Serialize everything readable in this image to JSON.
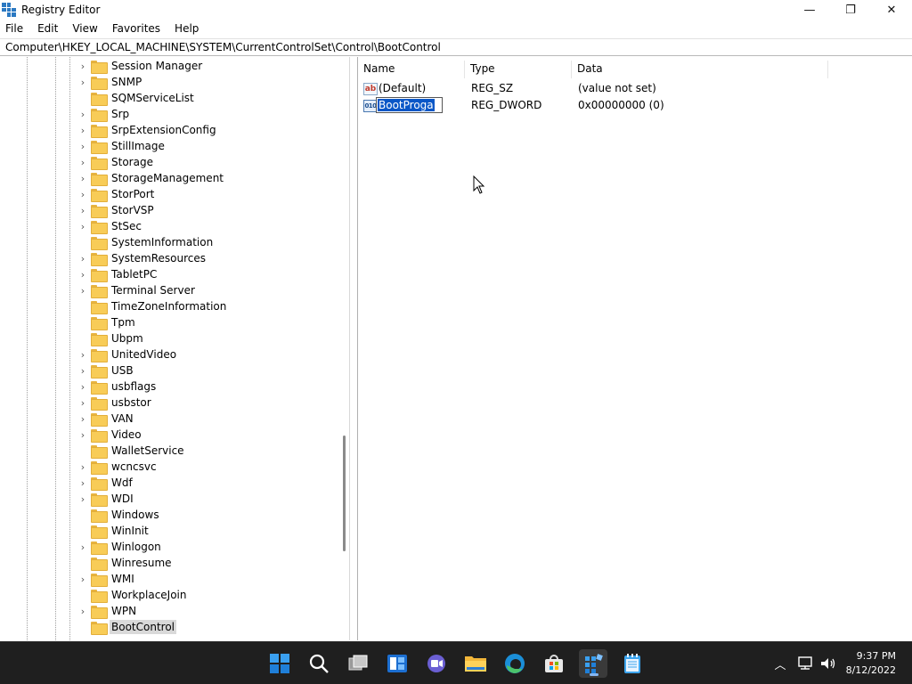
{
  "window": {
    "title": "Registry Editor",
    "minimize_glyph": "—",
    "maximize_glyph": "❐",
    "close_glyph": "✕"
  },
  "menu": [
    "File",
    "Edit",
    "View",
    "Favorites",
    "Help"
  ],
  "address": "Computer\\HKEY_LOCAL_MACHINE\\SYSTEM\\CurrentControlSet\\Control\\BootControl",
  "tree": [
    {
      "label": "Session Manager",
      "expandable": true
    },
    {
      "label": "SNMP",
      "expandable": true
    },
    {
      "label": "SQMServiceList",
      "expandable": false
    },
    {
      "label": "Srp",
      "expandable": true
    },
    {
      "label": "SrpExtensionConfig",
      "expandable": true
    },
    {
      "label": "StillImage",
      "expandable": true
    },
    {
      "label": "Storage",
      "expandable": true
    },
    {
      "label": "StorageManagement",
      "expandable": true
    },
    {
      "label": "StorPort",
      "expandable": true
    },
    {
      "label": "StorVSP",
      "expandable": true
    },
    {
      "label": "StSec",
      "expandable": true
    },
    {
      "label": "SystemInformation",
      "expandable": false
    },
    {
      "label": "SystemResources",
      "expandable": true
    },
    {
      "label": "TabletPC",
      "expandable": true
    },
    {
      "label": "Terminal Server",
      "expandable": true
    },
    {
      "label": "TimeZoneInformation",
      "expandable": false
    },
    {
      "label": "Tpm",
      "expandable": false
    },
    {
      "label": "Ubpm",
      "expandable": false
    },
    {
      "label": "UnitedVideo",
      "expandable": true
    },
    {
      "label": "USB",
      "expandable": true
    },
    {
      "label": "usbflags",
      "expandable": true
    },
    {
      "label": "usbstor",
      "expandable": true
    },
    {
      "label": "VAN",
      "expandable": true
    },
    {
      "label": "Video",
      "expandable": true
    },
    {
      "label": "WalletService",
      "expandable": false
    },
    {
      "label": "wcncsvc",
      "expandable": true
    },
    {
      "label": "Wdf",
      "expandable": true
    },
    {
      "label": "WDI",
      "expandable": true
    },
    {
      "label": "Windows",
      "expandable": false
    },
    {
      "label": "WinInit",
      "expandable": false
    },
    {
      "label": "Winlogon",
      "expandable": true
    },
    {
      "label": "Winresume",
      "expandable": false
    },
    {
      "label": "WMI",
      "expandable": true
    },
    {
      "label": "WorkplaceJoin",
      "expandable": false
    },
    {
      "label": "WPN",
      "expandable": true
    },
    {
      "label": "BootControl",
      "expandable": false,
      "selected": true
    }
  ],
  "list": {
    "columns": {
      "name": "Name",
      "type": "Type",
      "data": "Data"
    },
    "rows": [
      {
        "name": "(Default)",
        "type": "REG_SZ",
        "data": "(value not set)",
        "icon": "string-value-icon",
        "icon_text": "ab"
      },
      {
        "name": "BootProga",
        "type": "REG_DWORD",
        "data": "0x00000000 (0)",
        "icon": "binary-value-icon",
        "icon_text": "010",
        "editing": true
      }
    ]
  },
  "taskbar": {
    "time": "9:37 PM",
    "date": "8/12/2022",
    "icons": [
      "start-icon",
      "search-icon",
      "task-view-icon",
      "widgets-icon",
      "chat-icon",
      "file-explorer-icon",
      "edge-icon",
      "store-icon",
      "registry-editor-icon",
      "notepad-icon"
    ],
    "active_icon": "registry-editor-icon",
    "tray_chevron": "︿"
  }
}
